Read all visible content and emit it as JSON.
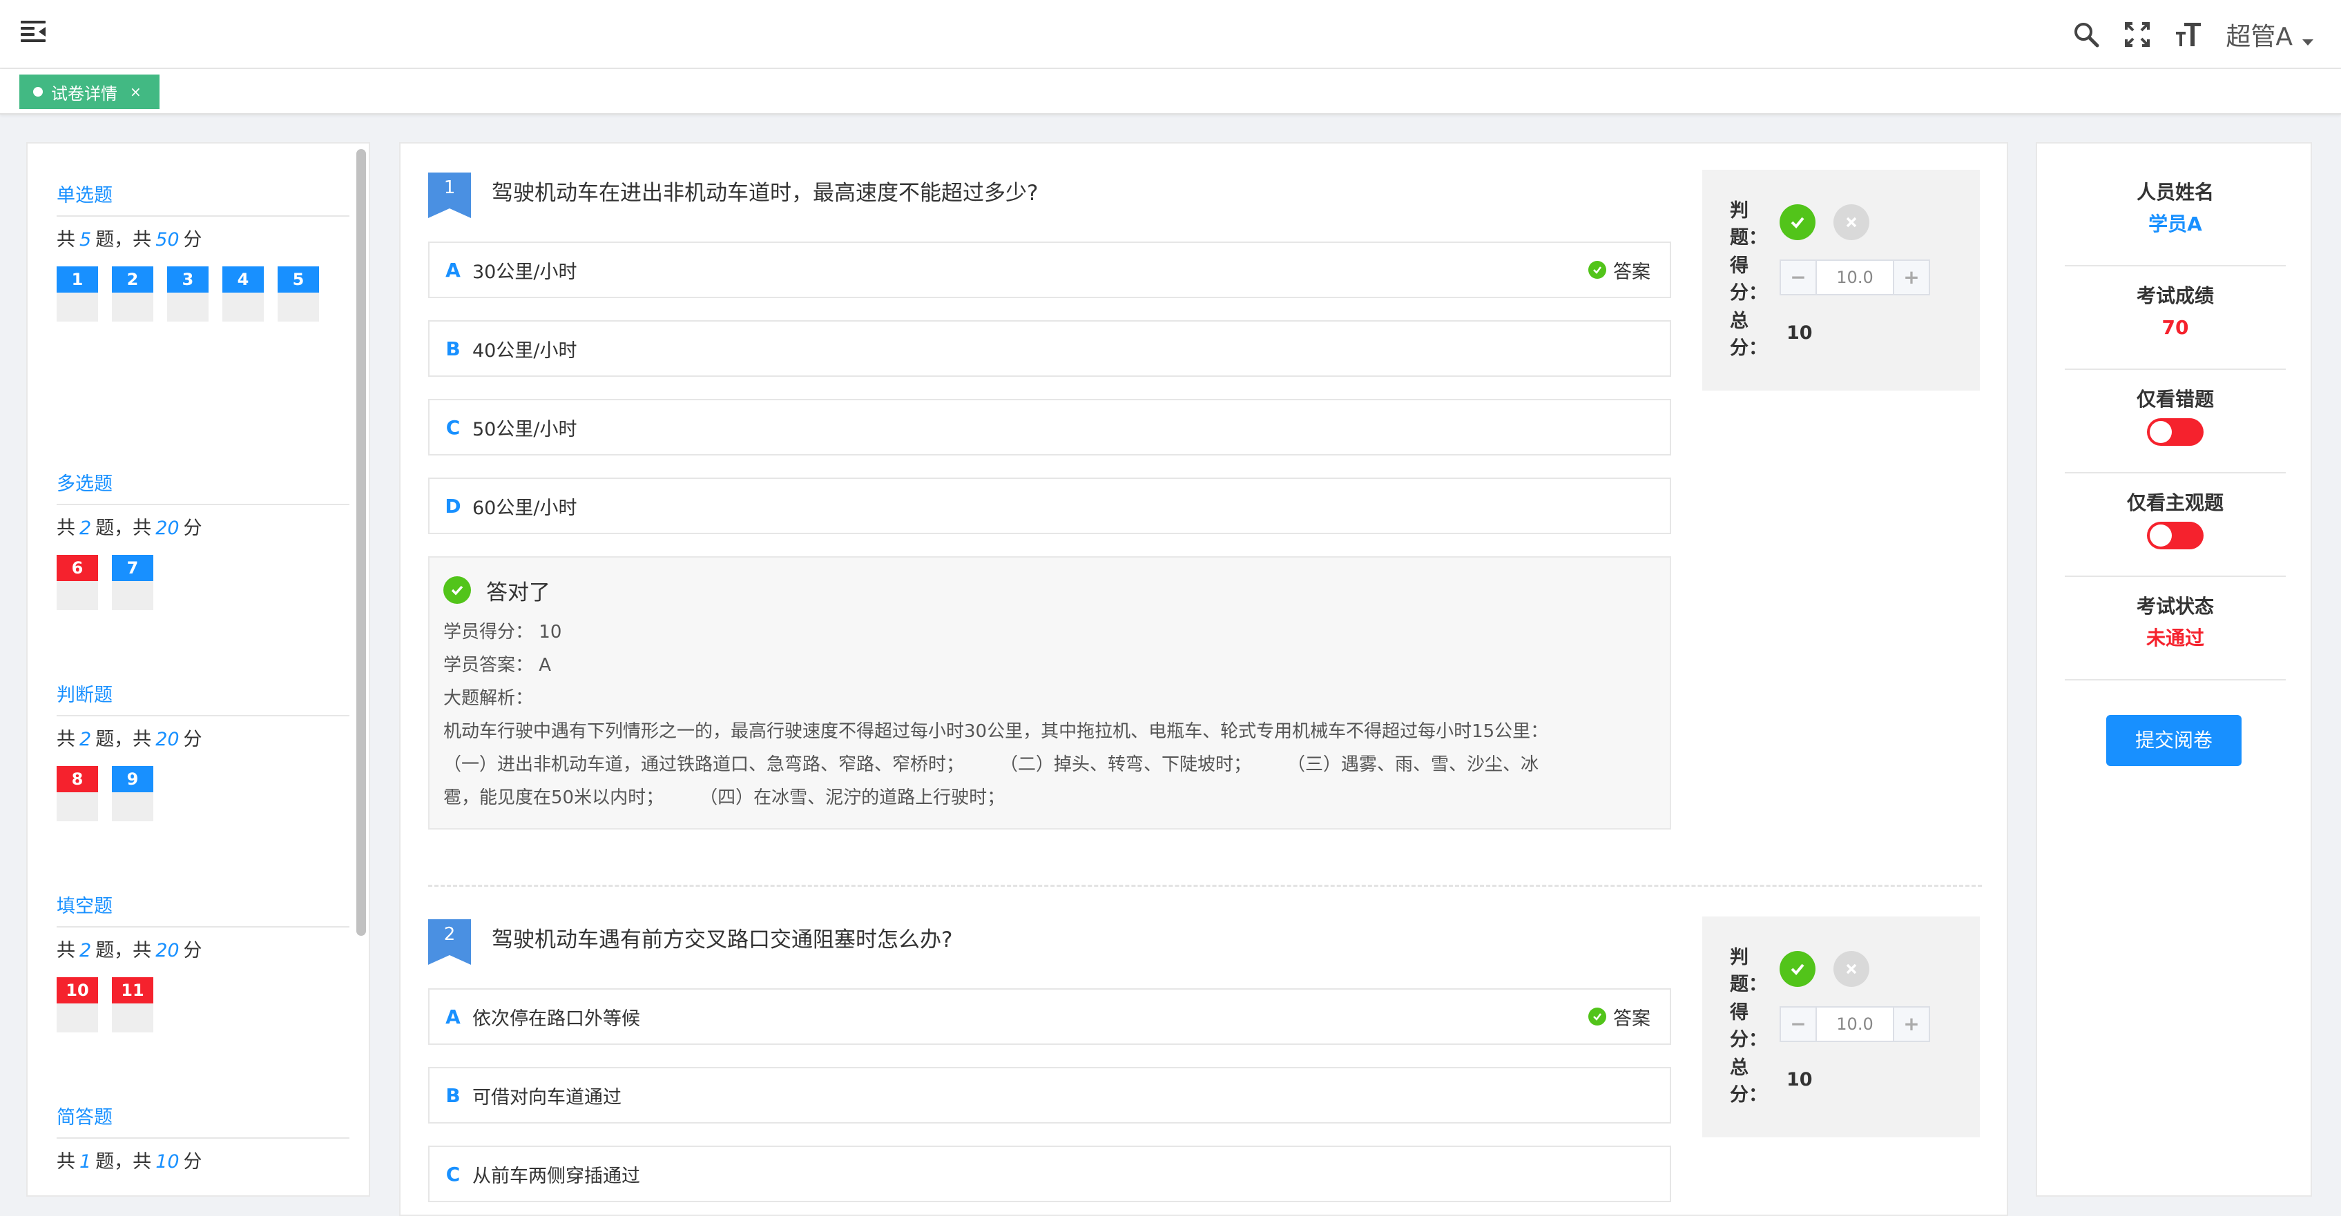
{
  "header": {
    "user_name": "超管A"
  },
  "tab": {
    "label": "试卷详情",
    "close": "×"
  },
  "sidebar": {
    "categories": [
      {
        "title": "单选题",
        "prefix": "共",
        "count": "5",
        "mid": "题，共",
        "score": "50",
        "suffix": "分",
        "questions": [
          {
            "num": "1",
            "status": "blue"
          },
          {
            "num": "2",
            "status": "blue"
          },
          {
            "num": "3",
            "status": "blue"
          },
          {
            "num": "4",
            "status": "blue"
          },
          {
            "num": "5",
            "status": "blue"
          }
        ]
      },
      {
        "title": "多选题",
        "prefix": "共",
        "count": "2",
        "mid": "题，共",
        "score": "20",
        "suffix": "分",
        "questions": [
          {
            "num": "6",
            "status": "red"
          },
          {
            "num": "7",
            "status": "blue"
          }
        ]
      },
      {
        "title": "判断题",
        "prefix": "共",
        "count": "2",
        "mid": "题，共",
        "score": "20",
        "suffix": "分",
        "questions": [
          {
            "num": "8",
            "status": "red"
          },
          {
            "num": "9",
            "status": "blue"
          }
        ]
      },
      {
        "title": "填空题",
        "prefix": "共",
        "count": "2",
        "mid": "题，共",
        "score": "20",
        "suffix": "分",
        "questions": [
          {
            "num": "10",
            "status": "red"
          },
          {
            "num": "11",
            "status": "red"
          }
        ]
      },
      {
        "title": "简答题",
        "prefix": "共",
        "count": "1",
        "mid": "题，共",
        "score": "10",
        "suffix": "分",
        "questions": []
      }
    ]
  },
  "questions": [
    {
      "number": "1",
      "title": "驾驶机动车在进出非机动车道时，最高速度不能超过多少?",
      "options": [
        {
          "letter": "A",
          "text": "30公里/小时",
          "is_answer": true
        },
        {
          "letter": "B",
          "text": "40公里/小时",
          "is_answer": false
        },
        {
          "letter": "C",
          "text": "50公里/小时",
          "is_answer": false
        },
        {
          "letter": "D",
          "text": "60公里/小时",
          "is_answer": false
        }
      ],
      "answer_label": "答案",
      "result": "答对了",
      "student_score_label": "学员得分：",
      "student_score": "10",
      "student_answer_label": "学员答案：",
      "student_answer": "A",
      "analysis_label": "大题解析：",
      "analysis_line1": "机动车行驶中遇有下列情形之一的，最高行驶速度不得超过每小时30公里，其中拖拉机、电瓶车、轮式专用机械车不得超过每小时15公里：",
      "analysis_line2": "（一）进出非机动车道，通过铁路道口、急弯路、窄路、窄桥时；　　　（二）掉头、转弯、下陡坡时；　　　（三）遇雾、雨、雪、沙尘、冰",
      "analysis_line3": "雹，能见度在50米以内时；　　　（四）在冰雪、泥泞的道路上行驶时；",
      "judge_label": "判题：",
      "score_label": "得分：",
      "score_value": "10.0",
      "total_label": "总分：",
      "total_value": "10"
    },
    {
      "number": "2",
      "title": "驾驶机动车遇有前方交叉路口交通阻塞时怎么办?",
      "options": [
        {
          "letter": "A",
          "text": "依次停在路口外等候",
          "is_answer": true
        },
        {
          "letter": "B",
          "text": "可借对向车道通过",
          "is_answer": false
        },
        {
          "letter": "C",
          "text": "从前车两侧穿插通过",
          "is_answer": false
        }
      ],
      "answer_label": "答案",
      "judge_label": "判题：",
      "score_label": "得分：",
      "score_value": "10.0",
      "total_label": "总分：",
      "total_value": "10"
    }
  ],
  "stepper": {
    "minus": "−",
    "plus": "+"
  },
  "info": {
    "name_label": "人员姓名",
    "name_value": "学员A",
    "score_label": "考试成绩",
    "score_value": "70",
    "wrong_only_label": "仅看错题",
    "subjective_only_label": "仅看主观题",
    "status_label": "考试状态",
    "status_value": "未通过",
    "submit_label": "提交阅卷"
  },
  "colors": {
    "primary": "#1890ff",
    "success": "#52c41a",
    "danger": "#f5222d",
    "tag": "#42b983"
  }
}
